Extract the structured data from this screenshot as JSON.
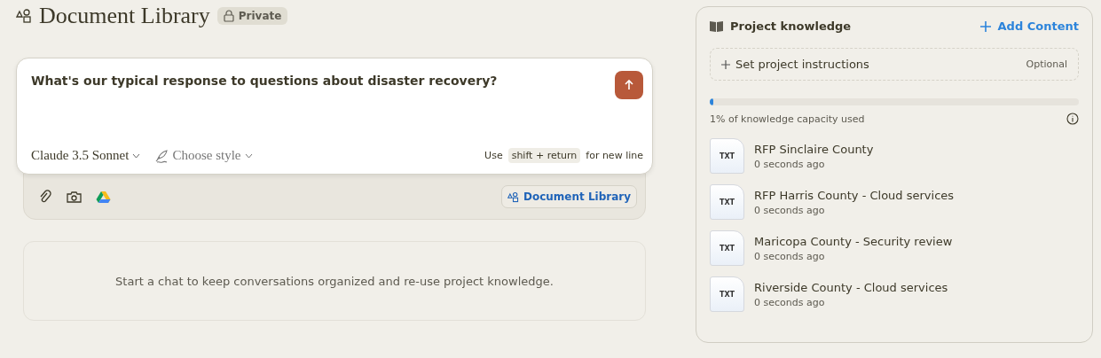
{
  "header": {
    "title": "Document Library",
    "badge": "Private"
  },
  "composer": {
    "value": "What's our typical response to questions about disaster recovery?",
    "model": "Claude 3.5 Sonnet",
    "style": "Choose style",
    "hint_before": "Use",
    "hint_key": "shift + return",
    "hint_after": "for new line",
    "project_chip": "Document Library"
  },
  "empty_state": "Start a chat to keep conversations organized and re-use project knowledge.",
  "knowledge": {
    "title": "Project knowledge",
    "add": "Add Content",
    "instructions": "Set project instructions",
    "optional": "Optional",
    "level": 0.01,
    "capacity": "1% of knowledge capacity used",
    "files": [
      {
        "type": "TXT",
        "name": "RFP Sinclaire County",
        "time": "0 seconds ago"
      },
      {
        "type": "TXT",
        "name": "RFP Harris County - Cloud services",
        "time": "0 seconds ago"
      },
      {
        "type": "TXT",
        "name": "Maricopa County - Security review",
        "time": "0 seconds ago"
      },
      {
        "type": "TXT",
        "name": "Riverside County - Cloud services",
        "time": "0 seconds ago"
      }
    ]
  }
}
